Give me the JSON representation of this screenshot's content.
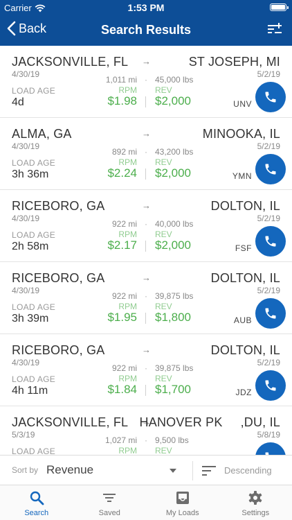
{
  "status_bar": {
    "carrier": "Carrier",
    "time": "1:53 PM"
  },
  "nav": {
    "back_label": "Back",
    "title": "Search Results"
  },
  "loads": [
    {
      "origin": "JACKSONVILLE, FL",
      "destination": "ST JOSEPH, MI",
      "pickup_date": "4/30/19",
      "delivery_date": "5/2/19",
      "miles": "1,011 mi",
      "weight": "45,000 lbs",
      "rpm_label": "RPM",
      "rev_label": "REV",
      "rpm": "$1.98",
      "revenue": "$2,000",
      "age_label": "LOAD AGE",
      "age": "4d",
      "code": "UNV"
    },
    {
      "origin": "ALMA, GA",
      "destination": "MINOOKA, IL",
      "pickup_date": "4/30/19",
      "delivery_date": "5/2/19",
      "miles": "892 mi",
      "weight": "43,200 lbs",
      "rpm_label": "RPM",
      "rev_label": "REV",
      "rpm": "$2.24",
      "revenue": "$2,000",
      "age_label": "LOAD AGE",
      "age": "3h 36m",
      "code": "YMN"
    },
    {
      "origin": "RICEBORO, GA",
      "destination": "DOLTON, IL",
      "pickup_date": "4/30/19",
      "delivery_date": "5/2/19",
      "miles": "922 mi",
      "weight": "40,000 lbs",
      "rpm_label": "RPM",
      "rev_label": "REV",
      "rpm": "$2.17",
      "revenue": "$2,000",
      "age_label": "LOAD AGE",
      "age": "2h 58m",
      "code": "FSF"
    },
    {
      "origin": "RICEBORO, GA",
      "destination": "DOLTON, IL",
      "pickup_date": "4/30/19",
      "delivery_date": "5/2/19",
      "miles": "922 mi",
      "weight": "39,875 lbs",
      "rpm_label": "RPM",
      "rev_label": "REV",
      "rpm": "$1.95",
      "revenue": "$1,800",
      "age_label": "LOAD AGE",
      "age": "3h 39m",
      "code": "AUB"
    },
    {
      "origin": "RICEBORO, GA",
      "destination": "DOLTON, IL",
      "pickup_date": "4/30/19",
      "delivery_date": "5/2/19",
      "miles": "922 mi",
      "weight": "39,875 lbs",
      "rpm_label": "RPM",
      "rev_label": "REV",
      "rpm": "$1.84",
      "revenue": "$1,700",
      "age_label": "LOAD AGE",
      "age": "4h 11m",
      "code": "JDZ"
    },
    {
      "origin": "JACKSONVILLE, FL",
      "destination": "HANOVER PK     ,DU, IL",
      "pickup_date": "5/3/19",
      "delivery_date": "5/8/19",
      "miles": "1,027 mi",
      "weight": "9,500 lbs",
      "rpm_label": "RPM",
      "rev_label": "REV",
      "rpm": "",
      "revenue": "",
      "age_label": "LOAD AGE",
      "age": "",
      "code": ""
    }
  ],
  "sort": {
    "label": "Sort by",
    "value": "Revenue",
    "order": "Descending"
  },
  "tabs": [
    {
      "label": "Search",
      "icon": "search-icon",
      "active": true
    },
    {
      "label": "Saved",
      "icon": "filter-list-icon",
      "active": false
    },
    {
      "label": "My Loads",
      "icon": "inbox-icon",
      "active": false
    },
    {
      "label": "Settings",
      "icon": "gear-icon",
      "active": false
    }
  ],
  "colors": {
    "brand": "#0d4e97",
    "accent": "#1467bd",
    "money": "#4cae4c"
  }
}
